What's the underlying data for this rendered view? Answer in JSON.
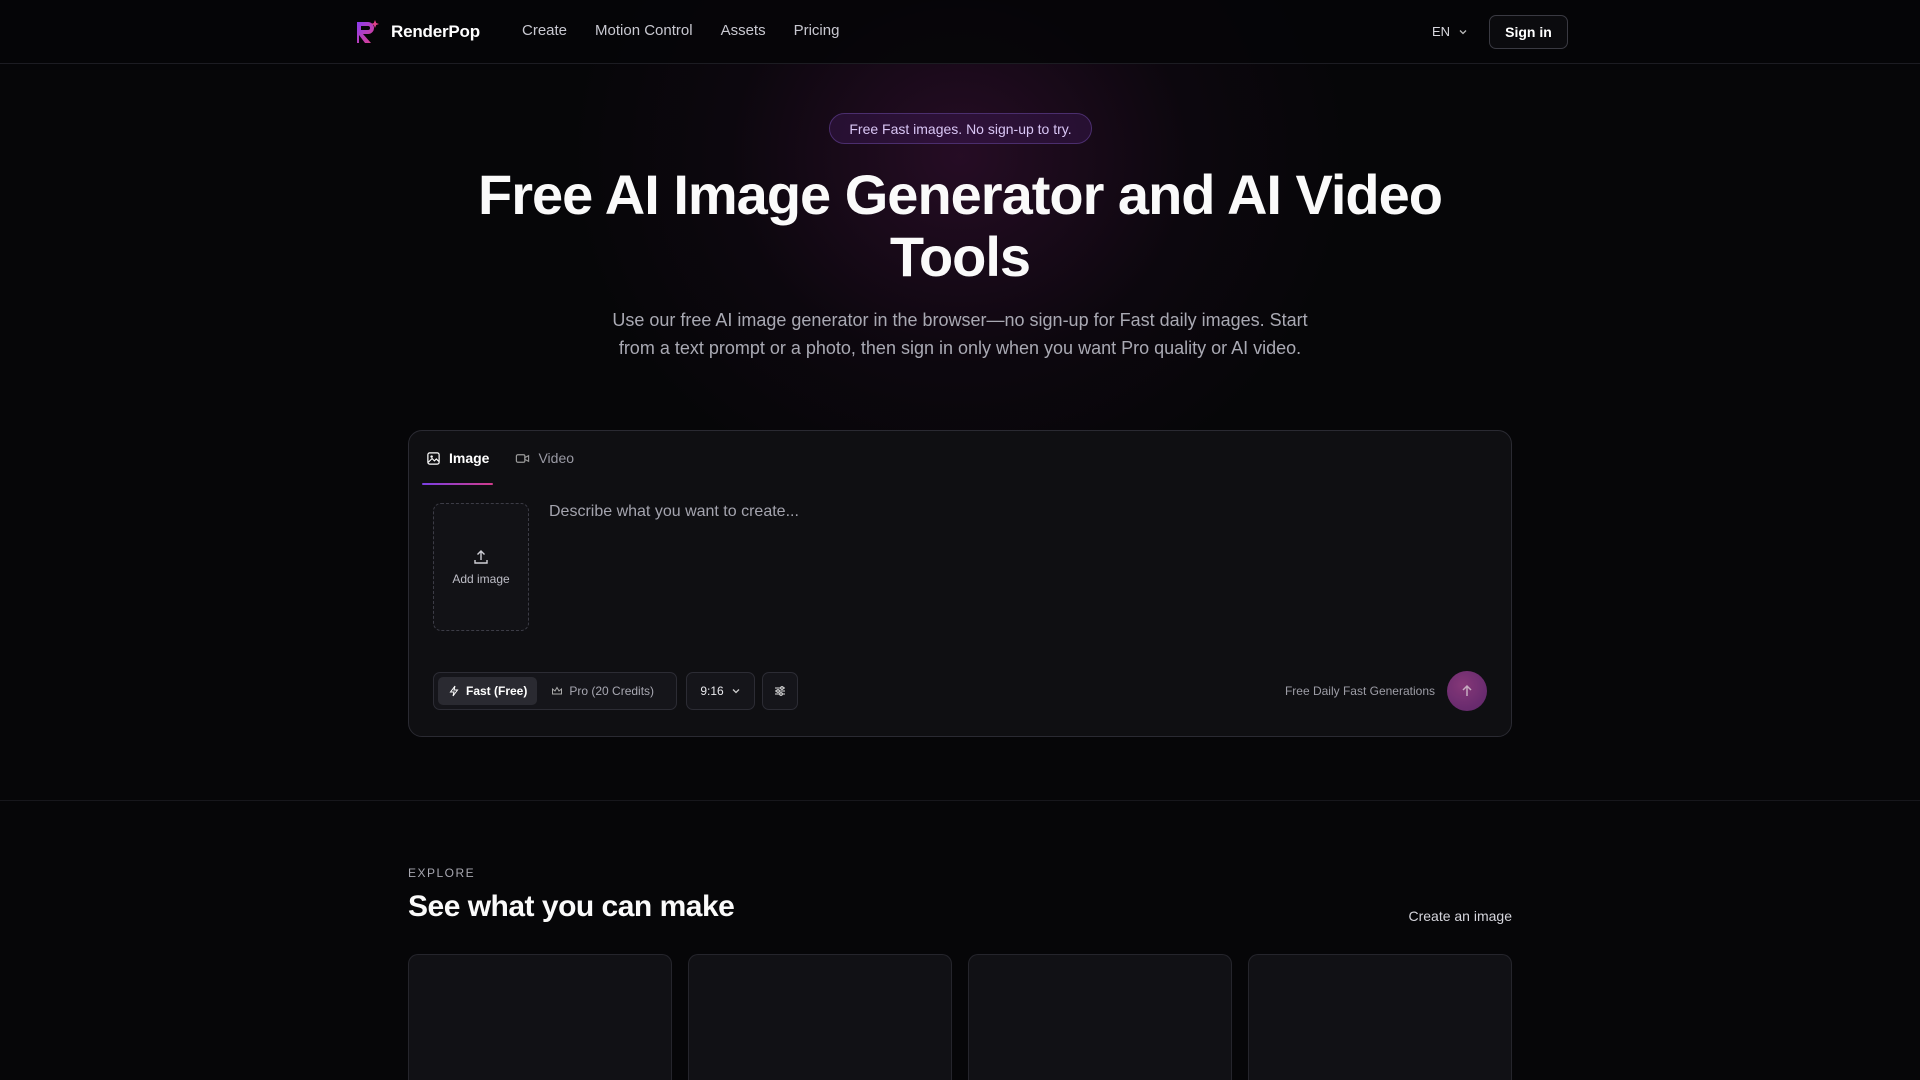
{
  "brand": {
    "name": "RenderPop"
  },
  "nav": {
    "links": [
      {
        "label": "Create"
      },
      {
        "label": "Motion Control"
      },
      {
        "label": "Assets"
      },
      {
        "label": "Pricing"
      }
    ],
    "language": "EN",
    "signin_label": "Sign in"
  },
  "hero": {
    "badge": "Free Fast images. No sign-up to try.",
    "title": "Free AI Image Generator and AI Video Tools",
    "subtitle": "Use our free AI image generator in the browser—no sign-up for Fast daily images. Start from a text prompt or a photo, then sign in only when you want Pro quality or AI video."
  },
  "generator": {
    "tabs": [
      {
        "label": "Image",
        "icon": "image-icon",
        "active": true
      },
      {
        "label": "Video",
        "icon": "video-icon",
        "active": false
      }
    ],
    "upload_label": "Add image",
    "prompt_placeholder": "Describe what you want to create...",
    "prompt_value": "",
    "modes": [
      {
        "label": "Fast (Free)",
        "icon": "bolt-icon",
        "active": true
      },
      {
        "label": "Pro (20 Credits)",
        "icon": "crown-icon",
        "active": false
      }
    ],
    "aspect_ratio": "9:16",
    "free_note": "Free Daily Fast Generations"
  },
  "explore": {
    "eyebrow": "EXPLORE",
    "title": "See what you can make",
    "link_label": "Create an image"
  },
  "colors": {
    "background": "#060608",
    "accent_purple": "#7b3fe4",
    "accent_pink": "#d13c8c"
  }
}
